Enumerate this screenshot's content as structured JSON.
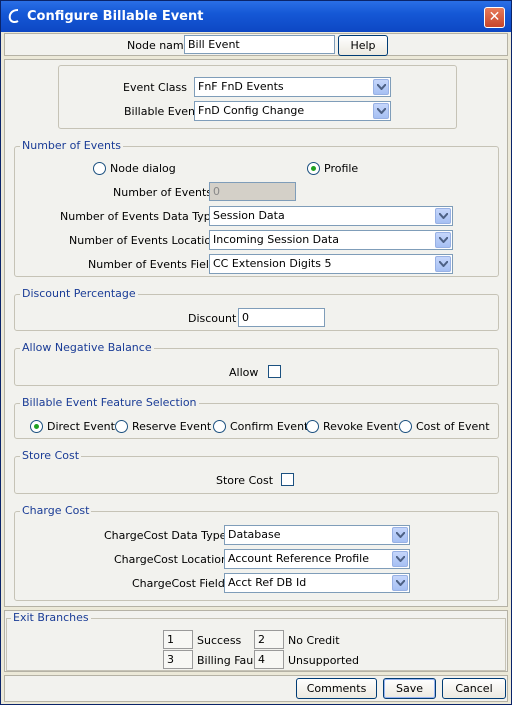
{
  "window": {
    "title": "Configure Billable Event"
  },
  "header": {
    "node_name_label": "Node name",
    "node_name_value": "Bill Event",
    "help_label": "Help"
  },
  "event": {
    "class_label": "Event Class",
    "class_value": "FnF FnD Events",
    "billable_label": "Billable Event",
    "billable_value": "FnD Config Change"
  },
  "number_of_events": {
    "title": "Number of Events",
    "radio_node_dialog": "Node dialog",
    "radio_profile": "Profile",
    "selected": "Profile",
    "count_label": "Number of Events",
    "count_value": "0",
    "data_type_label": "Number of Events Data Type",
    "data_type_value": "Session Data",
    "location_label": "Number of Events Location",
    "location_value": "Incoming Session Data",
    "field_label": "Number of Events Field",
    "field_value": "CC Extension Digits 5"
  },
  "discount": {
    "title": "Discount Percentage",
    "label": "Discount",
    "value": "0"
  },
  "negative": {
    "title": "Allow Negative Balance",
    "label": "Allow",
    "checked": false
  },
  "feature": {
    "title": "Billable Event Feature Selection",
    "options": [
      "Direct Event",
      "Reserve Event",
      "Confirm Event",
      "Revoke Event",
      "Cost of Event"
    ],
    "selected": "Direct Event"
  },
  "store_cost": {
    "title": "Store Cost",
    "label": "Store Cost",
    "checked": false
  },
  "charge_cost": {
    "title": "Charge Cost",
    "data_type_label": "ChargeCost Data Type",
    "data_type_value": "Database",
    "location_label": "ChargeCost Location",
    "location_value": "Account Reference Profile",
    "field_label": "ChargeCost Field",
    "field_value": "Acct Ref DB Id"
  },
  "exits": {
    "title": "Exit Branches",
    "items": [
      {
        "num": "1",
        "label": "Success"
      },
      {
        "num": "2",
        "label": "No Credit"
      },
      {
        "num": "3",
        "label": "Billing Fault"
      },
      {
        "num": "4",
        "label": "Unsupported"
      }
    ]
  },
  "footer": {
    "comments": "Comments",
    "save": "Save",
    "cancel": "Cancel"
  }
}
